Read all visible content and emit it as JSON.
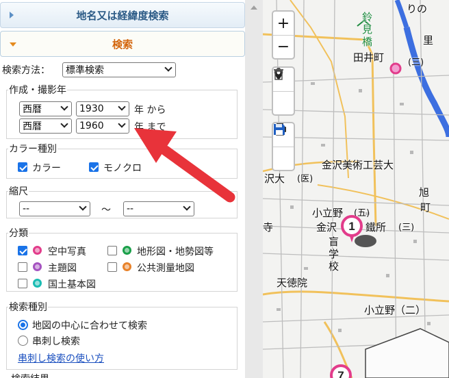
{
  "accordion": {
    "latlon_title": "地名又は経緯度検索",
    "search_title": "検索"
  },
  "method": {
    "label": "検索方法：",
    "value": "標準検索"
  },
  "year": {
    "legend": "作成・撮影年",
    "from_era": "西暦",
    "from_year": "1930",
    "from_suffix": "年 から",
    "to_era": "西暦",
    "to_year": "1960",
    "to_suffix": "年 まで"
  },
  "color": {
    "legend": "カラー種別",
    "color_label": "カラー",
    "color_checked": true,
    "mono_label": "モノクロ",
    "mono_checked": true
  },
  "scale": {
    "legend": "縮尺",
    "min": "--",
    "tilde": "～",
    "max": "--"
  },
  "category": {
    "legend": "分類",
    "items": [
      {
        "label": "空中写真",
        "checked": true,
        "color": "#e23c8b"
      },
      {
        "label": "地形図・地勢図等",
        "checked": false,
        "color": "#1aa04a"
      },
      {
        "label": "主題図",
        "checked": false,
        "color": "#a553c0"
      },
      {
        "label": "公共測量地図",
        "checked": false,
        "color": "#e8822a"
      },
      {
        "label": "国土基本図",
        "checked": false,
        "color": "#1abcb3"
      }
    ]
  },
  "search_type": {
    "legend": "検索種別",
    "option1": "地図の中心に合わせて検索",
    "option2": "串刺し検索",
    "selected": "地図の中心に合わせて検索",
    "help_link": "串刺し検索の使い方"
  },
  "result_partial": "検索結果",
  "map": {
    "labels": {
      "riono": "りの",
      "sato": "里",
      "suzumi": "鈴",
      "mi": "見",
      "bashi": "橋",
      "taicho": "田井町",
      "san1": "(三)",
      "kanazawa_art": "金沢美術工芸大",
      "sawaoi": "沢大",
      "i": "(医)",
      "akira": "旭",
      "machi": "町",
      "kodatsuno": "小立野",
      "go": "(五)",
      "kanazawa": "金沢",
      "terasaki": "寺",
      "kousho": "鐵所",
      "san2": "(三)",
      "mou": "盲",
      "gaku": "学",
      "kou": "校",
      "tentoku": "天徳院",
      "kodatsuno2": "小立野（二）"
    },
    "markers": [
      {
        "number": "1",
        "color": "#e23c8b"
      },
      {
        "number": "7",
        "color": "#e23c8b"
      }
    ],
    "controls": {
      "zoom_in": "+",
      "zoom_out": "−"
    }
  },
  "arrow_color": "#e8333a"
}
